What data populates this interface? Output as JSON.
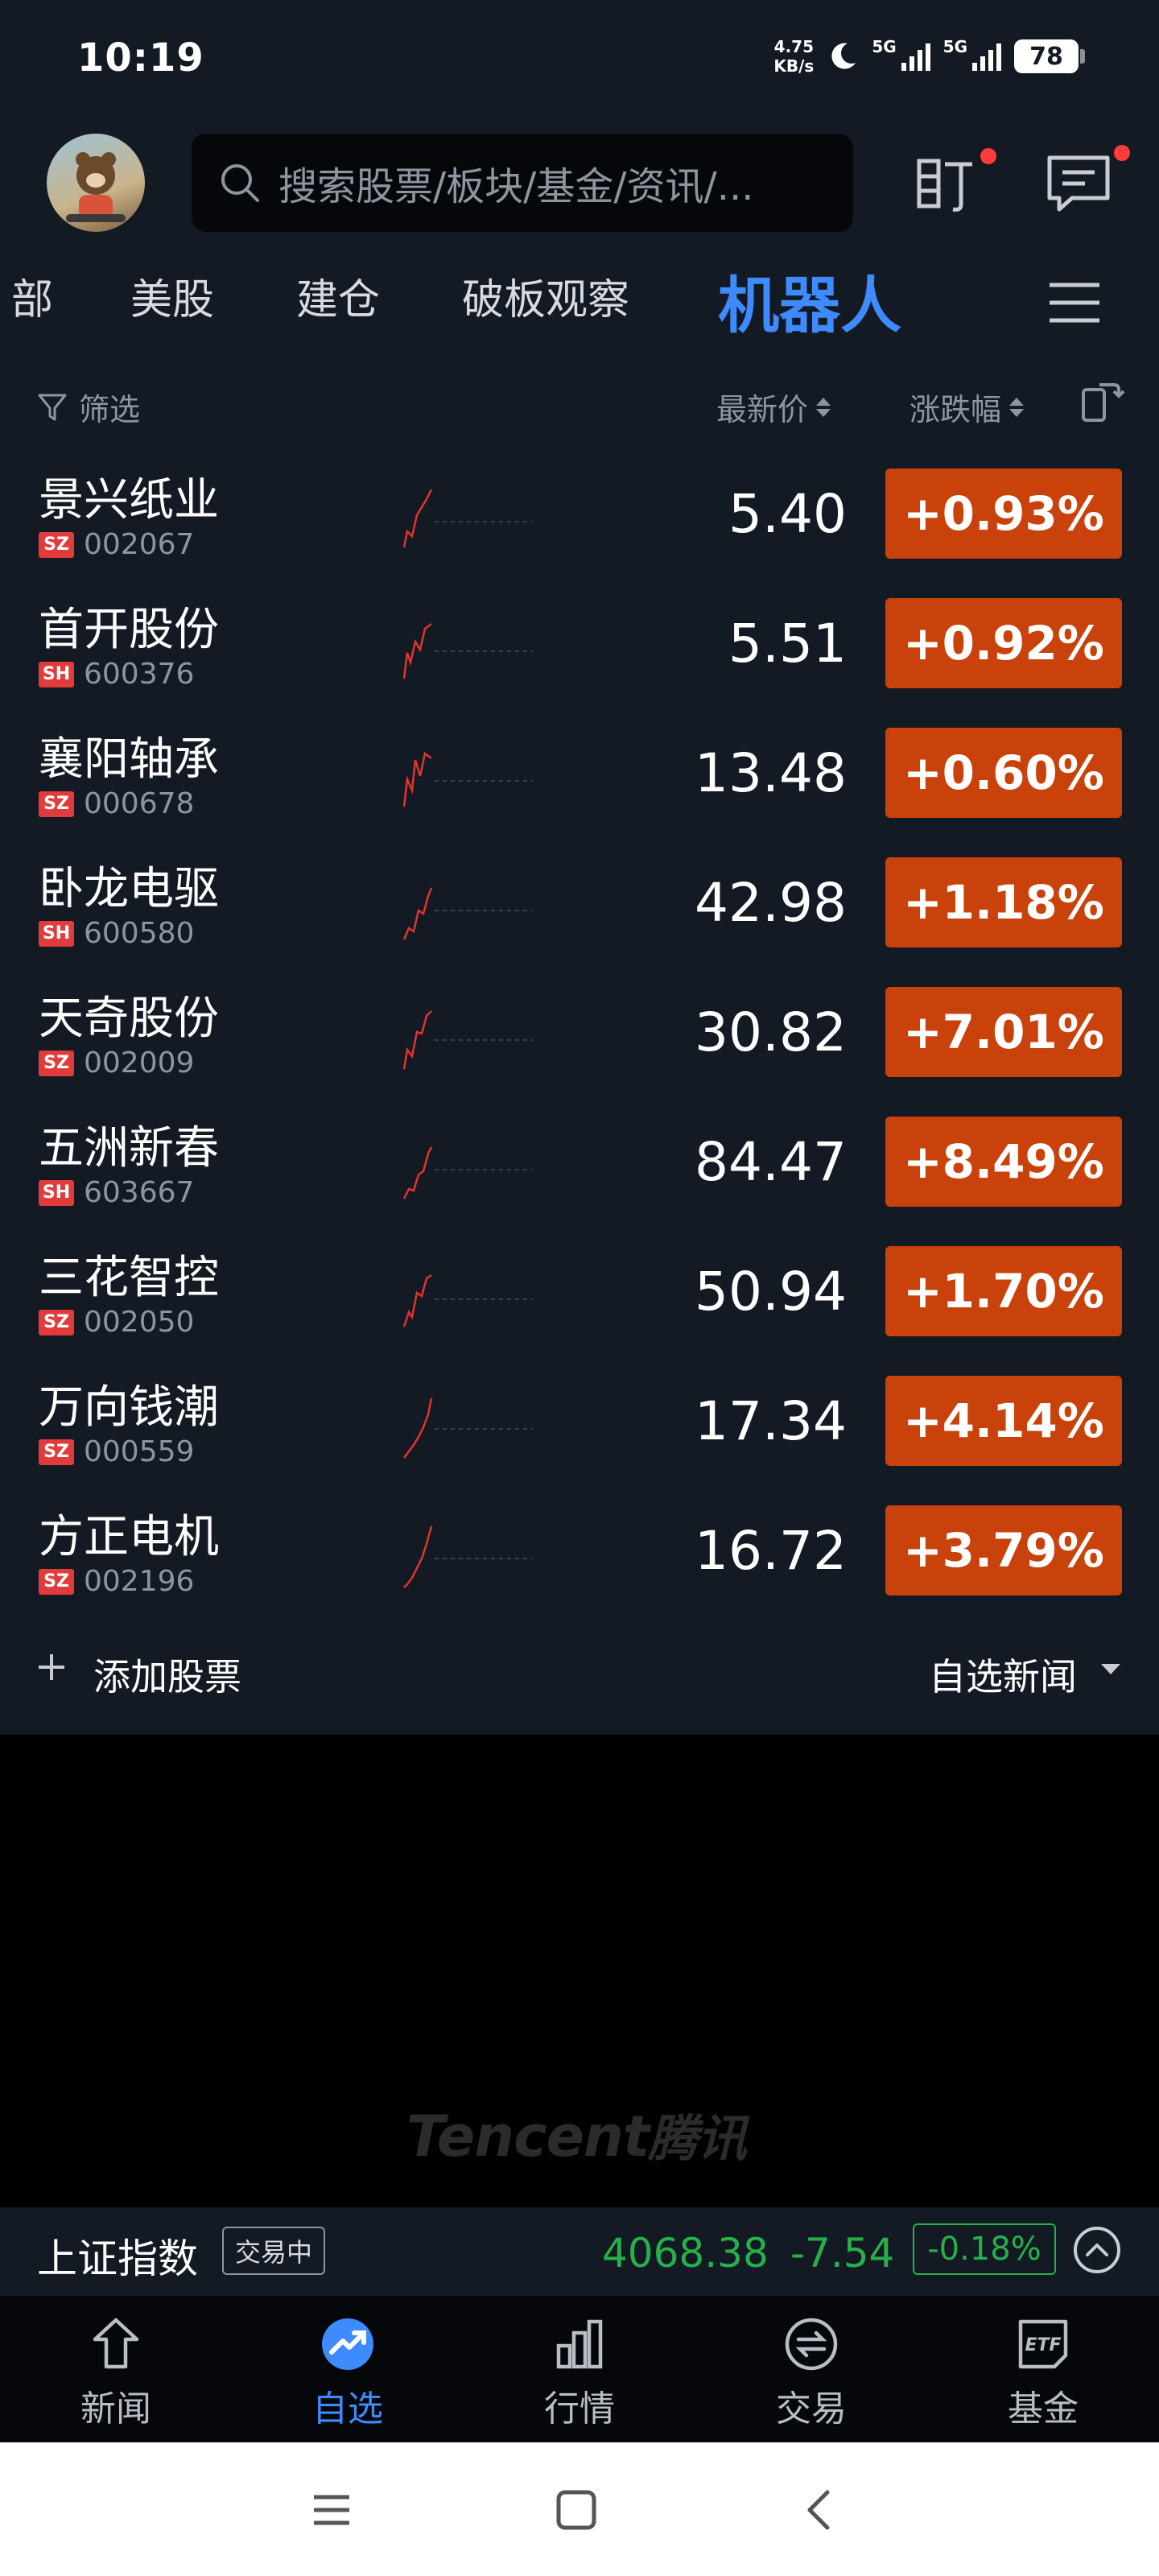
{
  "status_bar": {
    "time": "10:19",
    "net_speed_value": "4.75",
    "net_speed_unit": "KB/s",
    "sim1": "5G",
    "sim2": "5G",
    "battery": "78"
  },
  "header": {
    "search_placeholder": "搜索股票/板块/基金/资讯/...",
    "icons": [
      "avatar",
      "search-icon",
      "watch-icon",
      "message-icon"
    ]
  },
  "tabs": [
    {
      "label": "部",
      "active": false
    },
    {
      "label": "美股",
      "active": false
    },
    {
      "label": "建仓",
      "active": false
    },
    {
      "label": "破板观察",
      "active": false
    },
    {
      "label": "机器人",
      "active": true
    }
  ],
  "list_header": {
    "filter_label": "筛选",
    "price_label": "最新价",
    "change_label": "涨跌幅"
  },
  "stocks": [
    {
      "name": "景兴纸业",
      "market": "SZ",
      "code": "002067",
      "price": "5.40",
      "change": "+0.93%"
    },
    {
      "name": "首开股份",
      "market": "SH",
      "code": "600376",
      "price": "5.51",
      "change": "+0.92%"
    },
    {
      "name": "襄阳轴承",
      "market": "SZ",
      "code": "000678",
      "price": "13.48",
      "change": "+0.60%"
    },
    {
      "name": "卧龙电驱",
      "market": "SH",
      "code": "600580",
      "price": "42.98",
      "change": "+1.18%"
    },
    {
      "name": "天奇股份",
      "market": "SZ",
      "code": "002009",
      "price": "30.82",
      "change": "+7.01%"
    },
    {
      "name": "五洲新春",
      "market": "SH",
      "code": "603667",
      "price": "84.47",
      "change": "+8.49%"
    },
    {
      "name": "三花智控",
      "market": "SZ",
      "code": "002050",
      "price": "50.94",
      "change": "+1.70%"
    },
    {
      "name": "万向钱潮",
      "market": "SZ",
      "code": "000559",
      "price": "17.34",
      "change": "+4.14%"
    },
    {
      "name": "方正电机",
      "market": "SZ",
      "code": "002196",
      "price": "16.72",
      "change": "+3.79%"
    }
  ],
  "list_footer": {
    "add_label": "添加股票",
    "news_label": "自选新闻"
  },
  "watermark": "Tencent 腾讯",
  "index_ticker": {
    "name": "上证指数",
    "status": "交易中",
    "value": "4068.38",
    "change": "-7.54",
    "change_pct": "-0.18%"
  },
  "bottom_nav": [
    {
      "label": "新闻",
      "icon": "news-icon",
      "active": false
    },
    {
      "label": "自选",
      "icon": "watchlist-icon",
      "active": true
    },
    {
      "label": "行情",
      "icon": "market-icon",
      "active": false
    },
    {
      "label": "交易",
      "icon": "trade-icon",
      "active": false
    },
    {
      "label": "基金",
      "icon": "etf-icon",
      "active": false
    }
  ],
  "colors": {
    "background": "#141a24",
    "accent": "#3d8bff",
    "up": "#c9420b",
    "down": "#25b04a"
  }
}
